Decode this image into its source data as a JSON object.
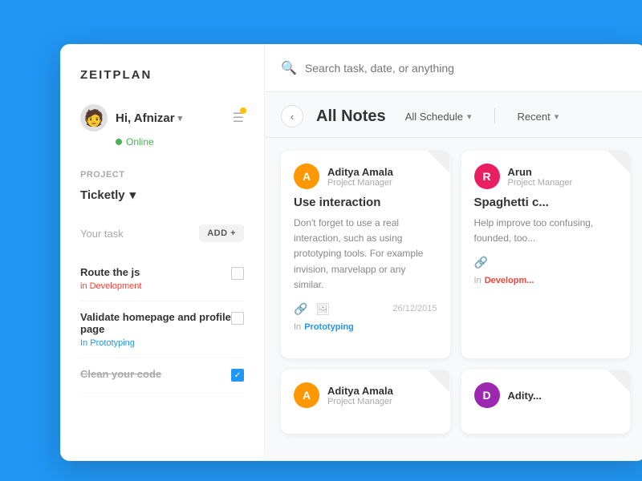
{
  "app": {
    "logo": "ZEITPLAN",
    "background_color": "#2196F3"
  },
  "sidebar": {
    "user": {
      "greeting": "Hi, Afnizar",
      "status": "Online",
      "chevron": "▾"
    },
    "project_label": "Project",
    "project_name": "Ticketly",
    "task_label": "Your task",
    "add_button": "ADD +",
    "tasks": [
      {
        "id": 1,
        "title": "Route the js",
        "project": "Development",
        "project_type": "dev",
        "label_prefix": "in",
        "checked": false
      },
      {
        "id": 2,
        "title": "Validate homepage and profile page",
        "project": "Prototyping",
        "project_type": "proto",
        "label_prefix": "In",
        "checked": false
      },
      {
        "id": 3,
        "title": "Clean your code",
        "project": "",
        "project_type": "",
        "label_prefix": "",
        "checked": true
      }
    ]
  },
  "search": {
    "placeholder": "Search task, date, or anything"
  },
  "notes": {
    "title": "All Notes",
    "filter1_label": "All Schedule",
    "filter2_label": "Recent",
    "back_icon": "‹",
    "cards": [
      {
        "id": 1,
        "user_name": "Aditya Amala",
        "user_role": "Project Manager",
        "avatar_color": "#FF9800",
        "avatar_letter": "A",
        "heading": "Use interaction",
        "body": "Don't forget to use a real interaction, such as using prototyping tools. For example invision, marvelapp or any similar.",
        "date": "26/12/2015",
        "project_label": "In",
        "project_name": "Prototyping",
        "project_type": "proto"
      },
      {
        "id": 2,
        "user_name": "Arun",
        "user_role": "Project Manager",
        "avatar_color": "#E91E63",
        "avatar_letter": "R",
        "heading": "Spaghetti c...",
        "body": "Help improve too confusing, founded, too...",
        "date": "",
        "project_label": "In",
        "project_name": "Developm...",
        "project_type": "dev"
      },
      {
        "id": 3,
        "user_name": "Aditya Amala",
        "user_role": "Project Manager",
        "avatar_color": "#FF9800",
        "avatar_letter": "A",
        "heading": "",
        "body": "",
        "date": "",
        "project_label": "",
        "project_name": "",
        "project_type": ""
      },
      {
        "id": 4,
        "user_name": "Adity...",
        "user_role": "",
        "avatar_color": "#9C27B0",
        "avatar_letter": "D",
        "heading": "",
        "body": "",
        "date": "",
        "project_label": "",
        "project_name": "",
        "project_type": ""
      }
    ]
  }
}
